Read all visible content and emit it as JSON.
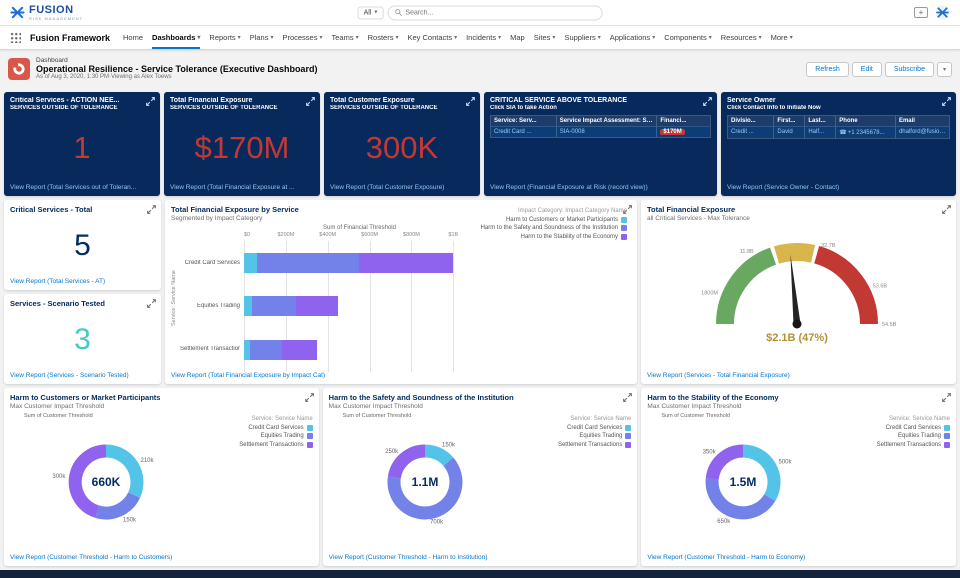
{
  "colors": {
    "accent": "#0176D3",
    "navy_card": "#08295B",
    "navy_text": "#032D60",
    "alert_red": "#C23934",
    "teal": "#3ECDC3",
    "light_link": "#8EC7F6",
    "gauge_value": "#B49137",
    "series_palette": [
      "#54C3E8",
      "#7382E9",
      "#8F63EE"
    ]
  },
  "utility": {
    "brand": "FUSION",
    "brand_sub": "RISK MANAGEMENT",
    "scope": "All",
    "search_placeholder": "Search..."
  },
  "nav": {
    "app": "Fusion Framework",
    "items": [
      {
        "label": "Home",
        "caret": false,
        "active": false
      },
      {
        "label": "Dashboards",
        "caret": true,
        "active": true
      },
      {
        "label": "Reports",
        "caret": true,
        "active": false
      },
      {
        "label": "Plans",
        "caret": true,
        "active": false
      },
      {
        "label": "Processes",
        "caret": true,
        "active": false
      },
      {
        "label": "Teams",
        "caret": true,
        "active": false
      },
      {
        "label": "Rosters",
        "caret": true,
        "active": false
      },
      {
        "label": "Key Contacts",
        "caret": true,
        "active": false
      },
      {
        "label": "Incidents",
        "caret": true,
        "active": false
      },
      {
        "label": "Map",
        "caret": false,
        "active": false
      },
      {
        "label": "Sites",
        "caret": true,
        "active": false
      },
      {
        "label": "Suppliers",
        "caret": true,
        "active": false
      },
      {
        "label": "Applications",
        "caret": true,
        "active": false
      },
      {
        "label": "Components",
        "caret": true,
        "active": false
      },
      {
        "label": "Resources",
        "caret": true,
        "active": false
      },
      {
        "label": "More",
        "caret": true,
        "active": false
      }
    ]
  },
  "header": {
    "record_type": "Dashboard",
    "title": "Operational Resilience - Service Tolerance (Executive Dashboard)",
    "meta": "As of Aug 3, 2020, 1:30 PM·Viewing as Alex Toews",
    "refresh": "Refresh",
    "edit": "Edit",
    "subscribe": "Subscribe"
  },
  "kpis": [
    {
      "title": "Critical Services - ACTION NEE...",
      "subtitle": "SERVICES OUTSIDE OF TOLERANCE",
      "value": "1",
      "footer": "View Report (Total Services out of Toleran..."
    },
    {
      "title": "Total Financial Exposure",
      "subtitle": "SERVICES OUTSIDE OF TOLERANCE",
      "value": "$170M",
      "footer": "View Report (Total Financial Exposure at ..."
    },
    {
      "title": "Total Customer Exposure",
      "subtitle": "SERVICES OUTSIDE OF TOLERANCE",
      "value": "300K",
      "footer": "View Report (Total Customer Exposure)"
    }
  ],
  "critical_table": {
    "title": "CRITICAL SERVICE ABOVE TOLERANCE",
    "subtitle": "Click SIA to take Action",
    "columns": [
      "Service: Serv...",
      "Service Impact Assessment: Servi...",
      "Financi..."
    ],
    "row": {
      "service": "Credit Card ...",
      "sia": "SIA-0008",
      "amount": "$170M"
    },
    "footer": "View Report (Financial Exposure at Risk (record view))"
  },
  "owner_table": {
    "title": "Service Owner",
    "subtitle": "Click Contact Info to Initiate Now",
    "columns": [
      "Divisio...",
      "First...",
      "Last...",
      "Phone",
      "Email"
    ],
    "row": {
      "division": "Credit ...",
      "first": "David",
      "last": "Half...",
      "phone": "+1 2345678...",
      "email": "dhalford@fusionr..."
    },
    "footer": "View Report (Service Owner - Contact)"
  },
  "stats": [
    {
      "title": "Critical Services - Total",
      "value": "5",
      "color": "#032D60",
      "footer": "View Report (Total Services - AT)"
    },
    {
      "title": "Services - Scenario Tested",
      "value": "3",
      "color": "#3ECDC3",
      "footer": "View Report (Services - Scenario Tested)"
    }
  ],
  "chart_data": [
    {
      "type": "bar",
      "orientation": "horizontal",
      "stacked": true,
      "title": "Total Financial Exposure by Service",
      "subtitle": "Segmented by Impact Category",
      "xlabel": "Sum of Financial Threshold",
      "ylabel": "Service: Service Name",
      "unit": "M",
      "xlim": [
        0,
        1075
      ],
      "categories": [
        "Credit Card Services",
        "Equities Trading",
        "Settlement Transactions"
      ],
      "series": [
        {
          "name": "Harm to Customers or Market Participants",
          "color": "#54C3E8",
          "values": [
            60,
            40,
            30
          ]
        },
        {
          "name": "Harm to the Safety and Soundness of the Institution",
          "color": "#7382E9",
          "values": [
            490,
            210,
            150
          ]
        },
        {
          "name": "Harm to the Stability of the Economy",
          "color": "#8F63EE",
          "values": [
            450,
            200,
            170
          ]
        }
      ],
      "ticks": [
        {
          "v": 0,
          "label": "$0"
        },
        {
          "v": 200,
          "label": "$200M"
        },
        {
          "v": 400,
          "label": "$400M"
        },
        {
          "v": 600,
          "label": "$600M"
        },
        {
          "v": 800,
          "label": "$800M"
        },
        {
          "v": 1000,
          "label": "$1B"
        }
      ],
      "legend_title": "Impact Category: Impact Category Name",
      "legend_position": "right",
      "grid": true,
      "footer": "View Report (Total Financial Exposure by Impact Cat)"
    },
    {
      "type": "gauge",
      "title": "Total Financial Exposure",
      "subtitle": "all Critical Services - Max Tolerance",
      "value_label": "$2.1B (47%)",
      "percent": 47,
      "segments": [
        {
          "color": "#69A860",
          "from": 0,
          "to": 40
        },
        {
          "color": "#D9B64B",
          "from": 40,
          "to": 58
        },
        {
          "color": "#C23934",
          "from": 58,
          "to": 100
        }
      ],
      "tick_labels": [
        {
          "pct": 12,
          "label": "1800M"
        },
        {
          "pct": 33,
          "label": "11.8B"
        },
        {
          "pct": 62,
          "label": "32.7B"
        },
        {
          "pct": 85,
          "label": "53.6B"
        },
        {
          "pct": 100,
          "label": "54.5B"
        }
      ],
      "footer": "View Report (Services - Total Financial Exposure)"
    },
    {
      "type": "pie",
      "title": "Harm to Customers or Market Participants",
      "subtitle": "Max Customer Impact Threshold",
      "axis_label": "Sum of Customer Threshold",
      "center": "660K",
      "legend_title": "Service: Service Name",
      "slices": [
        {
          "name": "Credit Card Services",
          "color": "#54C3E8",
          "value": 210000,
          "label": "210k"
        },
        {
          "name": "Equities Trading",
          "color": "#7382E9",
          "value": 150000,
          "label": "150k"
        },
        {
          "name": "Settlement Transactions",
          "color": "#8F63EE",
          "value": 300000,
          "label": "300k"
        }
      ],
      "footer": "View Report (Customer Threshold - Harm to Customers)"
    },
    {
      "type": "pie",
      "title": "Harm to the Safety and Soundness of the Institution",
      "subtitle": "Max Customer Impact Threshold",
      "axis_label": "Sum of Customer Threshold",
      "center": "1.1M",
      "legend_title": "Service: Service Name",
      "slices": [
        {
          "name": "Credit Card Services",
          "color": "#54C3E8",
          "value": 150000,
          "label": "150k"
        },
        {
          "name": "Equities Trading",
          "color": "#7382E9",
          "value": 700000,
          "label": "700k"
        },
        {
          "name": "Settlement Transactions",
          "color": "#8F63EE",
          "value": 250000,
          "label": "250k"
        }
      ],
      "footer": "View Report (Customer Threshold - Harm to Institution)"
    },
    {
      "type": "pie",
      "title": "Harm to the Stability of the Economy",
      "subtitle": "Max Customer Impact Threshold",
      "axis_label": "Sum of Customer Threshold",
      "center": "1.5M",
      "legend_title": "Service: Service Name",
      "slices": [
        {
          "name": "Credit Card Services",
          "color": "#54C3E8",
          "value": 500000,
          "label": "500k"
        },
        {
          "name": "Equities Trading",
          "color": "#7382E9",
          "value": 650000,
          "label": "650k"
        },
        {
          "name": "Settlement Transactions",
          "color": "#8F63EE",
          "value": 350000,
          "label": "350k"
        }
      ],
      "footer": "View Report (Customer Threshold - Harm to Economy)"
    }
  ]
}
